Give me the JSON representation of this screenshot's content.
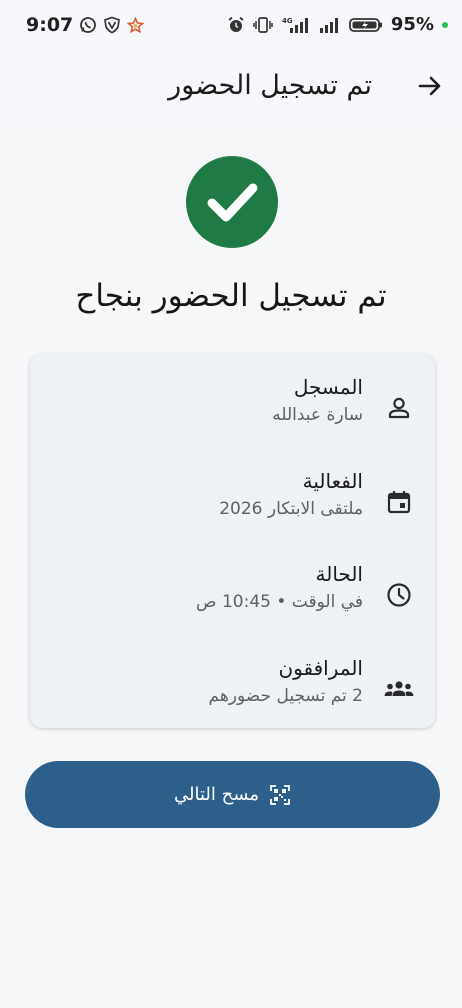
{
  "status_bar": {
    "time": "9:07",
    "battery": "95%"
  },
  "app_bar": {
    "title": "تم تسجيل الحضور",
    "back_icon": "arrow-forward-icon"
  },
  "success": {
    "icon": "check-circle-icon",
    "headline": "تم تسجيل الحضور بنجاح",
    "color": "#1f7a46"
  },
  "details": [
    {
      "icon": "person-icon",
      "label": "المسجل",
      "value": "سارة عبدالله"
    },
    {
      "icon": "calendar-icon",
      "label": "الفعالية",
      "value": "ملتقى الابتكار 2026"
    },
    {
      "icon": "clock-icon",
      "label": "الحالة",
      "value": "في الوقت • 10:45 ص"
    },
    {
      "icon": "group-icon",
      "label": "المرافقون",
      "value": "2 تم تسجيل حضورهم"
    }
  ],
  "actions": {
    "scan_next_label": "مسح التالي",
    "scan_icon": "qr-scan-icon",
    "button_color": "#2c5f8a"
  }
}
